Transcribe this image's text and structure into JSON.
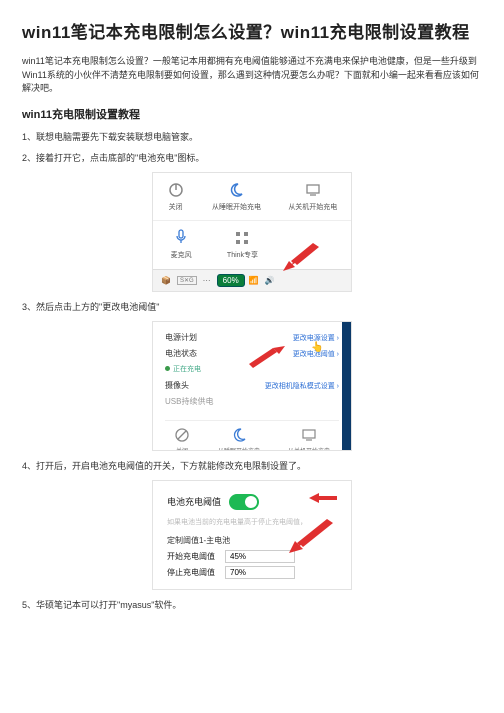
{
  "title": "win11笔记本充电限制怎么设置？win11充电限制设置教程",
  "intro": "win11笔记本充电限制怎么设置？一般笔记本用都拥有充电阈值能够通过不充满电来保护电池健康，但是一些升级到Win11系统的小伙伴不清楚充电限制要如何设置，那么遇到这种情况要怎么办呢？下面就和小编一起来看看应该如何解决吧。",
  "section_heading": "win11充电限制设置教程",
  "steps": {
    "s1": "1、联想电脑需要先下载安装联想电脑管家。",
    "s2": "2、接着打开它，点击底部的\"电池充电\"图标。",
    "s3": "3、然后点击上方的\"更改电池阈值\"",
    "s4": "4、打开后，开启电池充电阈值的开关，下方就能修改充电限制设置了。",
    "s5": "5、华硕笔记本可以打开\"myasus\"软件。"
  },
  "shot1": {
    "row1": {
      "a": "关闭",
      "b": "从睡眠开始充电",
      "c": "从关机开始充电"
    },
    "row2": {
      "a": "麦克风",
      "b": "Think专享"
    },
    "battery": "60%"
  },
  "shot2": {
    "plan_label": "电源计划",
    "plan_link": "更改电源设置",
    "status_label": "电池状态",
    "threshold_link": "更改电池阈值",
    "status_text": "正在充电",
    "camera_label": "摄像头",
    "privacy_link": "更改相机隐私模式设置",
    "usb_label": "USB持续供电",
    "ico1": "关闭",
    "ico2": "从睡眠开始充电",
    "ico3": "从关机开始充电"
  },
  "shot3": {
    "switch_label": "电池充电阈值",
    "note": "如果电池当前的充电电量高于停止充电阈值，",
    "sub_heading": "定制阈值1-主电池",
    "start_label": "开始充电阈值",
    "start_value": "45%",
    "stop_label": "停止充电阈值",
    "stop_value": "70%"
  }
}
